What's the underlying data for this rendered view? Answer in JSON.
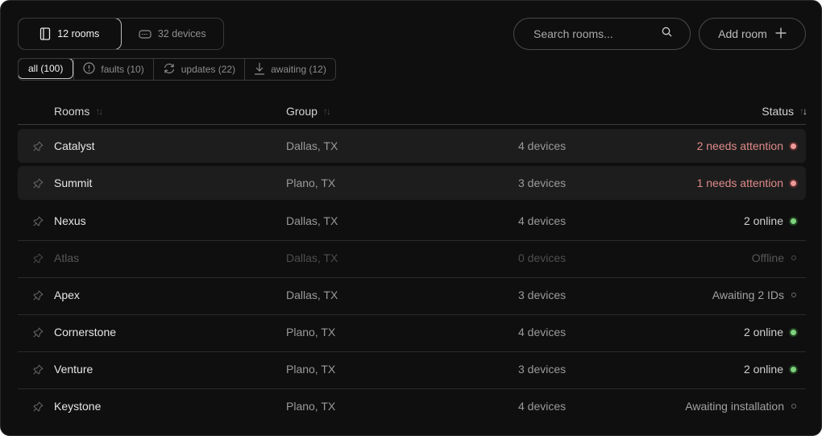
{
  "toggle": {
    "rooms_label": "12 rooms",
    "devices_label": "32 devices"
  },
  "search": {
    "placeholder": "Search rooms..."
  },
  "add_room_label": "Add room",
  "filters": [
    {
      "label": "all (100)",
      "icon": "none",
      "active": true
    },
    {
      "label": "faults (10)",
      "icon": "alert-circle-icon",
      "active": false
    },
    {
      "label": "updates (22)",
      "icon": "refresh-icon",
      "active": false
    },
    {
      "label": "awaiting (12)",
      "icon": "download-icon",
      "active": false
    }
  ],
  "columns": {
    "rooms": "Rooms",
    "group": "Group",
    "status": "Status"
  },
  "rows": [
    {
      "name": "Catalyst",
      "group": "Dallas, TX",
      "devices": "4 devices",
      "status": "2 needs attention",
      "state": "alert"
    },
    {
      "name": "Summit",
      "group": "Plano, TX",
      "devices": "3 devices",
      "status": "1 needs attention",
      "state": "alert"
    },
    {
      "name": "Nexus",
      "group": "Dallas, TX",
      "devices": "4 devices",
      "status": "2 online",
      "state": "online"
    },
    {
      "name": "Atlas",
      "group": "Dallas, TX",
      "devices": "0 devices",
      "status": "Offline",
      "state": "offline"
    },
    {
      "name": "Apex",
      "group": "Dallas, TX",
      "devices": "3 devices",
      "status": "Awaiting 2 IDs",
      "state": "awaiting"
    },
    {
      "name": "Cornerstone",
      "group": "Plano, TX",
      "devices": "4 devices",
      "status": "2 online",
      "state": "online"
    },
    {
      "name": "Venture",
      "group": "Plano, TX",
      "devices": "3 devices",
      "status": "2 online",
      "state": "online"
    },
    {
      "name": "Keystone",
      "group": "Plano, TX",
      "devices": "4 devices",
      "status": "Awaiting installation",
      "state": "awaiting"
    }
  ],
  "colors": {
    "background": "#0f0f0f",
    "alert": "#e08a8a",
    "online": "#7ed37e"
  }
}
